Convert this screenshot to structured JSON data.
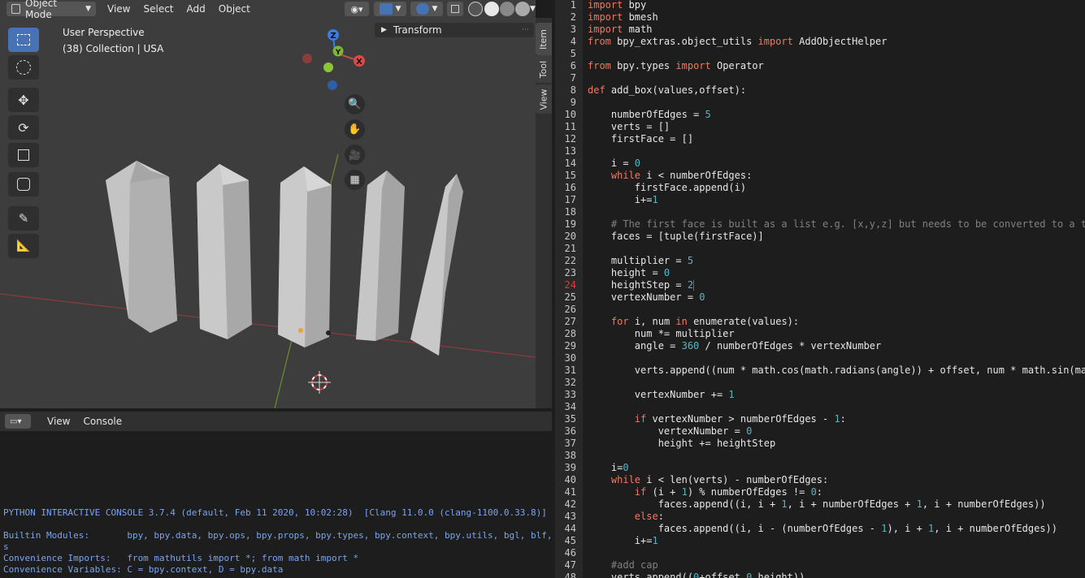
{
  "viewport": {
    "mode_label": "Object Mode",
    "menus": [
      "View",
      "Select",
      "Add",
      "Object"
    ],
    "overlay": {
      "perspective": "User Perspective",
      "collection": "(38) Collection | USA"
    },
    "transform_panel": "Transform",
    "side_tabs": [
      "Item",
      "Tool",
      "View"
    ],
    "gizmo": {
      "z": "Z",
      "y": "Y",
      "x": "X"
    },
    "colors": {
      "x_axis": "#c84a4a",
      "y_axis": "#7fb53a",
      "z_axis": "#3d7ce0",
      "grid_bg": "#3d3d3d",
      "object": "#b8b8b8"
    }
  },
  "console": {
    "menus": [
      "View",
      "Console"
    ],
    "lines": [
      "PYTHON INTERACTIVE CONSOLE 3.7.4 (default, Feb 11 2020, 10:02:28)  [Clang 11.0.0 (clang-1100.0.33.8)]",
      "",
      "Builtin Modules:       bpy, bpy.data, bpy.ops, bpy.props, bpy.types, bpy.context, bpy.utils, bgl, blf, mathutil",
      "s",
      "Convenience Imports:   from mathutils import *; from math import *",
      "Convenience Variables: C = bpy.context, D = bpy.data"
    ]
  },
  "editor": {
    "current_line": 24,
    "lines": [
      {
        "n": "1",
        "code": "import bpy"
      },
      {
        "n": "2",
        "code": "import bmesh"
      },
      {
        "n": "3",
        "code": "import math"
      },
      {
        "n": "4",
        "code": "from bpy_extras.object_utils import AddObjectHelper"
      },
      {
        "n": "5",
        "code": ""
      },
      {
        "n": "6",
        "code": "from bpy.types import Operator"
      },
      {
        "n": "7",
        "code": ""
      },
      {
        "n": "8",
        "code": "def add_box(values,offset):"
      },
      {
        "n": "9",
        "code": ""
      },
      {
        "n": "10",
        "code": "    numberOfEdges = 5"
      },
      {
        "n": "11",
        "code": "    verts = []"
      },
      {
        "n": "12",
        "code": "    firstFace = []"
      },
      {
        "n": "13",
        "code": ""
      },
      {
        "n": "14",
        "code": "    i = 0"
      },
      {
        "n": "15",
        "code": "    while i < numberOfEdges:"
      },
      {
        "n": "16",
        "code": "        firstFace.append(i)"
      },
      {
        "n": "17",
        "code": "        i+=1"
      },
      {
        "n": "18",
        "code": ""
      },
      {
        "n": "19",
        "code": "    # The first face is built as a list e.g. [x,y,z] but needs to be converted to a tupl"
      },
      {
        "n": "20",
        "code": "    faces = [tuple(firstFace)]"
      },
      {
        "n": "21",
        "code": ""
      },
      {
        "n": "22",
        "code": "    multiplier = 5"
      },
      {
        "n": "23",
        "code": "    height = 0"
      },
      {
        "n": "24",
        "code": "    heightStep = 2"
      },
      {
        "n": "25",
        "code": "    vertexNumber = 0"
      },
      {
        "n": "26",
        "code": ""
      },
      {
        "n": "27",
        "code": "    for i, num in enumerate(values):"
      },
      {
        "n": "28",
        "code": "        num *= multiplier"
      },
      {
        "n": "29",
        "code": "        angle = 360 / numberOfEdges * vertexNumber"
      },
      {
        "n": "30",
        "code": ""
      },
      {
        "n": "31",
        "code": "        verts.append((num * math.cos(math.radians(angle)) + offset, num * math.sin(math"
      },
      {
        "n": "32",
        "code": ""
      },
      {
        "n": "33",
        "code": "        vertexNumber += 1"
      },
      {
        "n": "34",
        "code": ""
      },
      {
        "n": "35",
        "code": "        if vertexNumber > numberOfEdges - 1:"
      },
      {
        "n": "36",
        "code": "            vertexNumber = 0"
      },
      {
        "n": "37",
        "code": "            height += heightStep"
      },
      {
        "n": "38",
        "code": ""
      },
      {
        "n": "39",
        "code": "    i=0"
      },
      {
        "n": "40",
        "code": "    while i < len(verts) - numberOfEdges:"
      },
      {
        "n": "41",
        "code": "        if (i + 1) % numberOfEdges != 0:"
      },
      {
        "n": "42",
        "code": "            faces.append((i, i + 1, i + numberOfEdges + 1, i + numberOfEdges))"
      },
      {
        "n": "43",
        "code": "        else:"
      },
      {
        "n": "44",
        "code": "            faces.append((i, i - (numberOfEdges - 1), i + 1, i + numberOfEdges))"
      },
      {
        "n": "45",
        "code": "        i+=1"
      },
      {
        "n": "46",
        "code": ""
      },
      {
        "n": "47",
        "code": "    #add cap"
      },
      {
        "n": "48",
        "code": "    verts.append((0+offset,0,height))"
      }
    ]
  }
}
